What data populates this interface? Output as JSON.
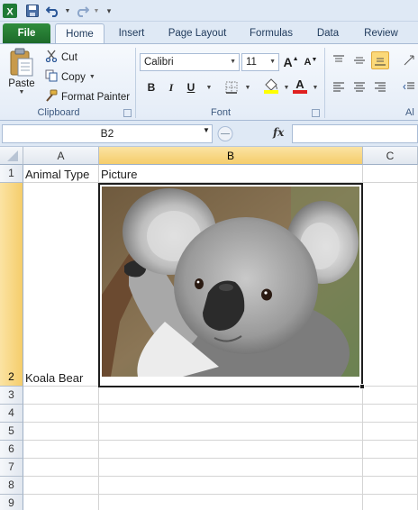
{
  "quick_access": {
    "icons": [
      "excel-logo-icon",
      "save-icon",
      "undo-icon",
      "redo-icon",
      "customize-icon"
    ]
  },
  "tabs": [
    {
      "label": "File"
    },
    {
      "label": "Home"
    },
    {
      "label": "Insert"
    },
    {
      "label": "Page Layout"
    },
    {
      "label": "Formulas"
    },
    {
      "label": "Data"
    },
    {
      "label": "Review"
    }
  ],
  "ribbon": {
    "clipboard": {
      "paste_label": "Paste",
      "cut_label": "Cut",
      "copy_label": "Copy",
      "format_painter_label": "Format Painter",
      "group_label": "Clipboard"
    },
    "font": {
      "font_name": "Calibri",
      "font_size": "11",
      "bold": "B",
      "italic": "I",
      "underline": "U",
      "grow_font": "A",
      "shrink_font": "A",
      "font_color_letter": "A",
      "group_label": "Font",
      "highlight_color": "#ffff00",
      "font_color": "#e02020"
    },
    "alignment": {
      "group_label": "Al"
    }
  },
  "formula_bar": {
    "name_box": "B2",
    "fx_label": "fx",
    "formula": ""
  },
  "sheet": {
    "columns": [
      "A",
      "B",
      "C"
    ],
    "selected_column": "B",
    "rows": [
      "1",
      "2",
      "3",
      "4",
      "5",
      "6",
      "7",
      "8",
      "9"
    ],
    "selected_row": "2",
    "cells": {
      "A1": "Animal Type",
      "B1": "Picture",
      "A2": "Koala Bear"
    },
    "picture": {
      "subject": "koala",
      "description_icon": "koala-photo"
    }
  },
  "colors": {
    "ribbon_bg": "#dfe9f5",
    "file_tab": "#2f8d3d",
    "selection_header": "#f5cd6b",
    "gridline": "#d4d4d4"
  }
}
